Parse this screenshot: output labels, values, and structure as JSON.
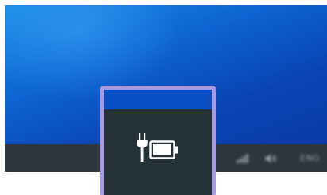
{
  "desktop": {
    "wallpaper_colors": [
      "#1a8ee6",
      "#0d64d2",
      "#0a3aa8"
    ]
  },
  "taskbar": {
    "background": "#2b363d",
    "tray": {
      "network_icon": "network-icon",
      "volume_icon": "volume-icon",
      "language_label": "ENG"
    }
  },
  "magnifier": {
    "border_color": "#a89ae0",
    "icon": "battery-charging-icon"
  }
}
